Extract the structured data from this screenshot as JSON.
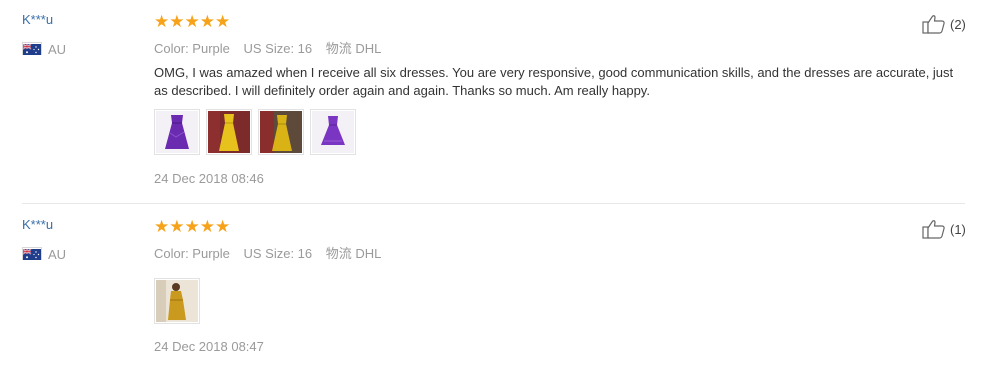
{
  "reviews": [
    {
      "user": "K***u",
      "country": "AU",
      "rating_stars": "★★★★★",
      "rating": 5,
      "color_label": "Color: Purple",
      "size_label": "US Size: 16",
      "shipping_label": "物流 DHL",
      "text": "OMG, I was amazed when I receive all six dresses. You are very responsive, good communication skills, and the dresses are accurate, just as described. I will definitely order again and again. Thanks so much. Am really happy.",
      "thumbnails": [
        {
          "icon": "purple-dress-photo",
          "color": "#6a2bb0"
        },
        {
          "icon": "yellow-dress-photo",
          "color": "#e8c21c"
        },
        {
          "icon": "yellow-dress-photo",
          "color": "#d9b316"
        },
        {
          "icon": "purple-dress-photo",
          "color": "#7a35c2"
        }
      ],
      "date": "24 Dec 2018 08:46",
      "helpful": "(2)"
    },
    {
      "user": "K***u",
      "country": "AU",
      "rating_stars": "★★★★★",
      "rating": 5,
      "color_label": "Color: Purple",
      "size_label": "US Size: 16",
      "shipping_label": "物流 DHL",
      "text": "",
      "thumbnails": [
        {
          "icon": "mustard-dress-photo",
          "color": "#c99a1e"
        }
      ],
      "date": "24 Dec 2018 08:47",
      "helpful": "(1)"
    }
  ],
  "colors": {
    "user_link": "#3a6fa8",
    "star": "#f7a21b",
    "meta": "#9a9a9a",
    "divider": "#e8e8e8"
  }
}
